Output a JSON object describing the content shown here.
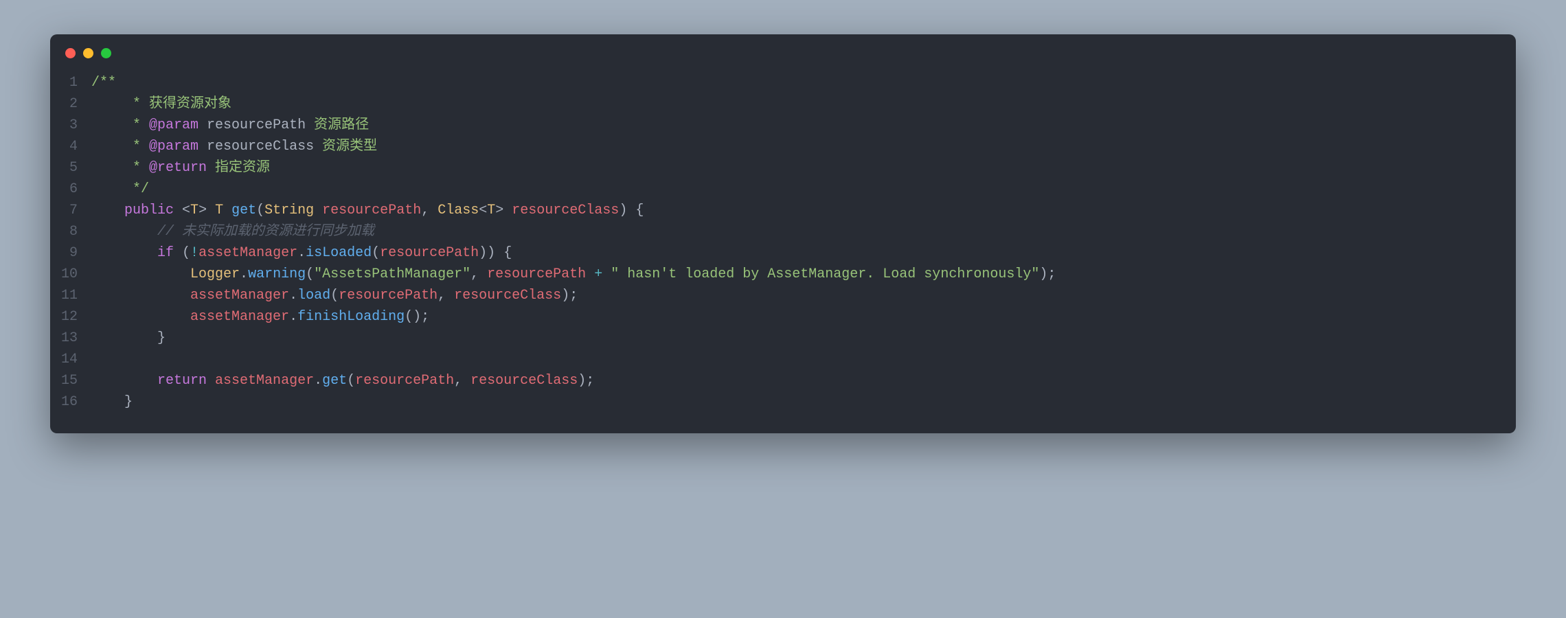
{
  "colors": {
    "background": "#a2afbd",
    "editor_bg": "#282c34",
    "red_dot": "#ff5f56",
    "yellow_dot": "#ffbd2e",
    "green_dot": "#27c93f",
    "gutter": "#5c6370",
    "text": "#abb2bf",
    "keyword": "#c678dd",
    "type": "#e5c07b",
    "method": "#61afef",
    "ident": "#e06c75",
    "string": "#98c379",
    "op": "#56b6c2",
    "comment": "#5c6370"
  },
  "line_numbers": [
    "1",
    "2",
    "3",
    "4",
    "5",
    "6",
    "7",
    "8",
    "9",
    "10",
    "11",
    "12",
    "13",
    "14",
    "15",
    "16"
  ],
  "code_lines": [
    [
      {
        "cls": "c-docgreen",
        "text": "/**"
      }
    ],
    [
      {
        "cls": "c-docgreen",
        "text": "     * 获得资源对象"
      }
    ],
    [
      {
        "cls": "c-docgreen",
        "text": "     * "
      },
      {
        "cls": "c-doctag",
        "text": "@param"
      },
      {
        "cls": "c-docgreen",
        "text": " "
      },
      {
        "cls": "c-docvar",
        "text": "resourcePath"
      },
      {
        "cls": "c-docgreen",
        "text": " 资源路径"
      }
    ],
    [
      {
        "cls": "c-docgreen",
        "text": "     * "
      },
      {
        "cls": "c-doctag",
        "text": "@param"
      },
      {
        "cls": "c-docgreen",
        "text": " "
      },
      {
        "cls": "c-docvar",
        "text": "resourceClass"
      },
      {
        "cls": "c-docgreen",
        "text": " 资源类型"
      }
    ],
    [
      {
        "cls": "c-docgreen",
        "text": "     * "
      },
      {
        "cls": "c-doctag",
        "text": "@return"
      },
      {
        "cls": "c-docgreen",
        "text": " 指定资源"
      }
    ],
    [
      {
        "cls": "c-docgreen",
        "text": "     */"
      }
    ],
    [
      {
        "cls": "c-plain",
        "text": "    "
      },
      {
        "cls": "c-keyword",
        "text": "public"
      },
      {
        "cls": "c-plain",
        "text": " <"
      },
      {
        "cls": "c-type",
        "text": "T"
      },
      {
        "cls": "c-plain",
        "text": "> "
      },
      {
        "cls": "c-type",
        "text": "T"
      },
      {
        "cls": "c-plain",
        "text": " "
      },
      {
        "cls": "c-method",
        "text": "get"
      },
      {
        "cls": "c-paren",
        "text": "("
      },
      {
        "cls": "c-type",
        "text": "String"
      },
      {
        "cls": "c-plain",
        "text": " "
      },
      {
        "cls": "c-ident",
        "text": "resourcePath"
      },
      {
        "cls": "c-plain",
        "text": ", "
      },
      {
        "cls": "c-type",
        "text": "Class"
      },
      {
        "cls": "c-plain",
        "text": "<"
      },
      {
        "cls": "c-type",
        "text": "T"
      },
      {
        "cls": "c-plain",
        "text": "> "
      },
      {
        "cls": "c-ident",
        "text": "resourceClass"
      },
      {
        "cls": "c-paren",
        "text": ")"
      },
      {
        "cls": "c-plain",
        "text": " {"
      }
    ],
    [
      {
        "cls": "c-plain",
        "text": "        "
      },
      {
        "cls": "c-comment",
        "text": "// 未实际加载的资源进行同步加载"
      }
    ],
    [
      {
        "cls": "c-plain",
        "text": "        "
      },
      {
        "cls": "c-keyword",
        "text": "if"
      },
      {
        "cls": "c-plain",
        "text": " ("
      },
      {
        "cls": "c-op",
        "text": "!"
      },
      {
        "cls": "c-ident",
        "text": "assetManager"
      },
      {
        "cls": "c-plain",
        "text": "."
      },
      {
        "cls": "c-method",
        "text": "isLoaded"
      },
      {
        "cls": "c-paren",
        "text": "("
      },
      {
        "cls": "c-ident",
        "text": "resourcePath"
      },
      {
        "cls": "c-paren",
        "text": "))"
      },
      {
        "cls": "c-plain",
        "text": " {"
      }
    ],
    [
      {
        "cls": "c-plain",
        "text": "            "
      },
      {
        "cls": "c-type",
        "text": "Logger"
      },
      {
        "cls": "c-plain",
        "text": "."
      },
      {
        "cls": "c-method",
        "text": "warning"
      },
      {
        "cls": "c-paren",
        "text": "("
      },
      {
        "cls": "c-string",
        "text": "\"AssetsPathManager\""
      },
      {
        "cls": "c-plain",
        "text": ", "
      },
      {
        "cls": "c-ident",
        "text": "resourcePath"
      },
      {
        "cls": "c-plain",
        "text": " "
      },
      {
        "cls": "c-op",
        "text": "+"
      },
      {
        "cls": "c-plain",
        "text": " "
      },
      {
        "cls": "c-string",
        "text": "\" hasn't loaded by AssetManager. Load synchronously\""
      },
      {
        "cls": "c-paren",
        "text": ")"
      },
      {
        "cls": "c-plain",
        "text": ";"
      }
    ],
    [
      {
        "cls": "c-plain",
        "text": "            "
      },
      {
        "cls": "c-ident",
        "text": "assetManager"
      },
      {
        "cls": "c-plain",
        "text": "."
      },
      {
        "cls": "c-method",
        "text": "load"
      },
      {
        "cls": "c-paren",
        "text": "("
      },
      {
        "cls": "c-ident",
        "text": "resourcePath"
      },
      {
        "cls": "c-plain",
        "text": ", "
      },
      {
        "cls": "c-ident",
        "text": "resourceClass"
      },
      {
        "cls": "c-paren",
        "text": ")"
      },
      {
        "cls": "c-plain",
        "text": ";"
      }
    ],
    [
      {
        "cls": "c-plain",
        "text": "            "
      },
      {
        "cls": "c-ident",
        "text": "assetManager"
      },
      {
        "cls": "c-plain",
        "text": "."
      },
      {
        "cls": "c-method",
        "text": "finishLoading"
      },
      {
        "cls": "c-paren",
        "text": "()"
      },
      {
        "cls": "c-plain",
        "text": ";"
      }
    ],
    [
      {
        "cls": "c-plain",
        "text": "        }"
      }
    ],
    [
      {
        "cls": "c-plain",
        "text": ""
      }
    ],
    [
      {
        "cls": "c-plain",
        "text": "        "
      },
      {
        "cls": "c-keyword",
        "text": "return"
      },
      {
        "cls": "c-plain",
        "text": " "
      },
      {
        "cls": "c-ident",
        "text": "assetManager"
      },
      {
        "cls": "c-plain",
        "text": "."
      },
      {
        "cls": "c-method",
        "text": "get"
      },
      {
        "cls": "c-paren",
        "text": "("
      },
      {
        "cls": "c-ident",
        "text": "resourcePath"
      },
      {
        "cls": "c-plain",
        "text": ", "
      },
      {
        "cls": "c-ident",
        "text": "resourceClass"
      },
      {
        "cls": "c-paren",
        "text": ")"
      },
      {
        "cls": "c-plain",
        "text": ";"
      }
    ],
    [
      {
        "cls": "c-plain",
        "text": "    }"
      }
    ]
  ]
}
